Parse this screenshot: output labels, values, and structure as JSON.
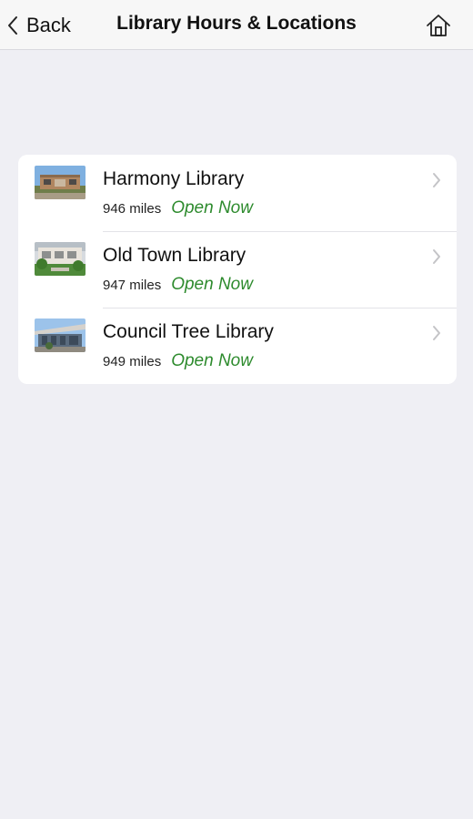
{
  "header": {
    "back_label": "Back",
    "title": "Library Hours & Locations",
    "home_icon": "home-icon"
  },
  "libraries": [
    {
      "name": "Harmony Library",
      "distance": "946 miles",
      "status": "Open Now",
      "thumbnail_icon": "harmony-library-photo"
    },
    {
      "name": "Old Town Library",
      "distance": "947 miles",
      "status": "Open Now",
      "thumbnail_icon": "old-town-library-photo"
    },
    {
      "name": "Council Tree Library",
      "distance": "949 miles",
      "status": "Open Now",
      "thumbnail_icon": "council-tree-library-photo"
    }
  ],
  "colors": {
    "background": "#efeff4",
    "card": "#ffffff",
    "status_open": "#2e8b2e",
    "chevron": "#c4c4c7"
  }
}
